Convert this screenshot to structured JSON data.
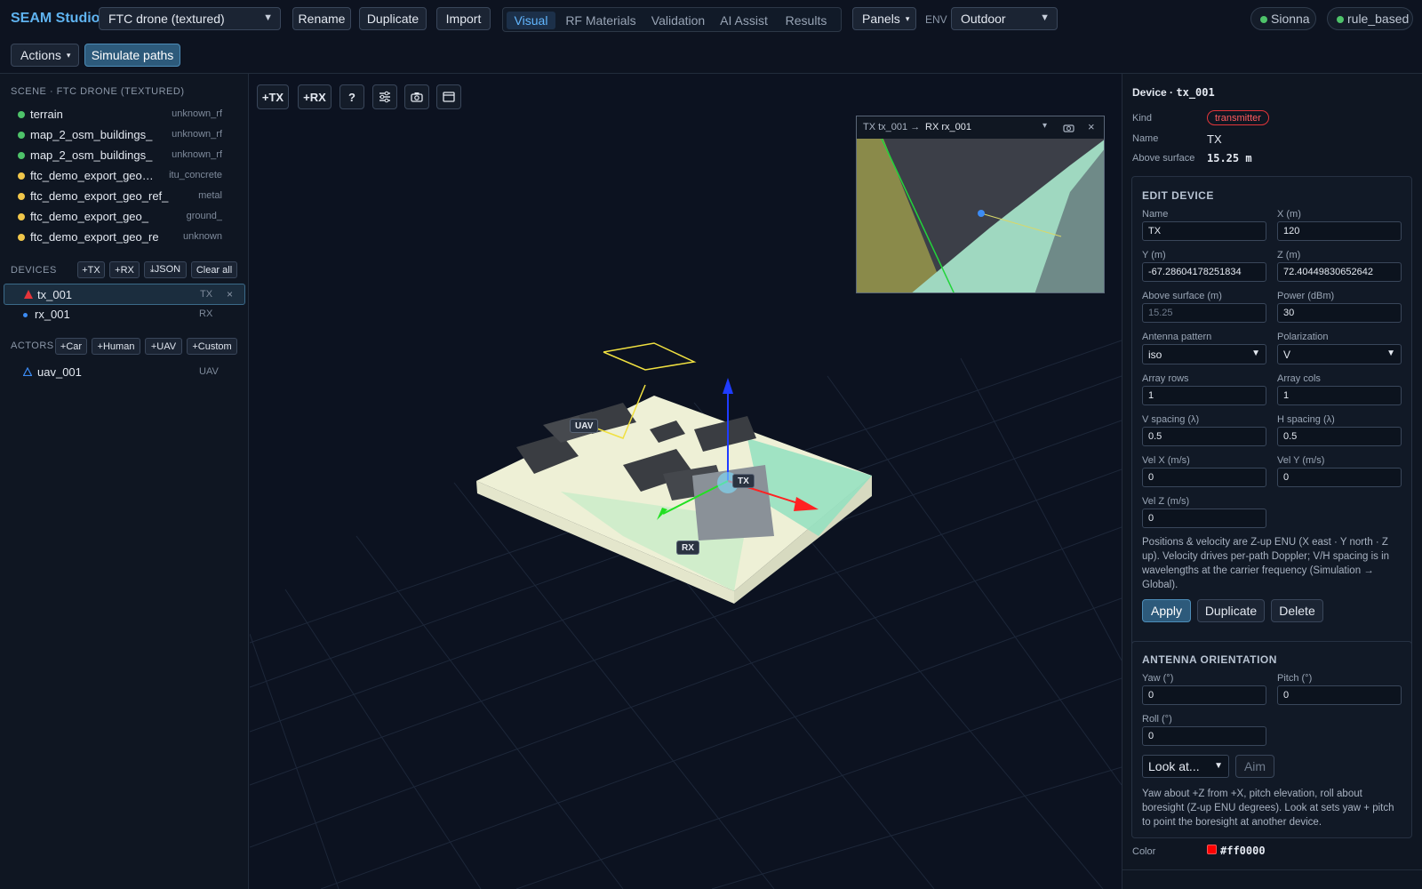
{
  "app": {
    "brand": "SEAM Studio",
    "scene_select": "FTC drone (textured)",
    "rename": "Rename",
    "duplicate": "Duplicate",
    "import": "Import",
    "tabs": [
      "Visual",
      "RF Materials",
      "Validation",
      "AI Assist",
      "Results"
    ],
    "panels": "Panels",
    "env_label": "ENV",
    "env_value": "Outdoor",
    "status_pills": [
      "Sionna",
      "rule_based"
    ],
    "actions": "Actions",
    "simulate": "Simulate paths"
  },
  "scene": {
    "title": "SCENE · FTC DRONE (TEXTURED)",
    "items": [
      {
        "name": "terrain",
        "tag": "unknown_rf",
        "color": "#4ec36a"
      },
      {
        "name": "map_2_osm_buildings_",
        "tag": "unknown_rf",
        "color": "#4ec36a"
      },
      {
        "name": "map_2_osm_buildings_",
        "tag": "unknown_rf",
        "color": "#4ec36a"
      },
      {
        "name": "ftc_demo_export_geo_ref",
        "tag": "itu_concrete",
        "color": "#f0c64a"
      },
      {
        "name": "ftc_demo_export_geo_ref_",
        "tag": "metal",
        "color": "#f0c64a"
      },
      {
        "name": "ftc_demo_export_geo_",
        "tag": "ground_",
        "color": "#f0c64a"
      },
      {
        "name": "ftc_demo_export_geo_re",
        "tag": "unknown",
        "color": "#f0c64a"
      }
    ]
  },
  "devices": {
    "title": "DEVICES",
    "buttons": [
      "+TX",
      "+RX",
      "⤓JSON",
      "Clear all"
    ],
    "items": [
      {
        "name": "tx_001",
        "kind": "TX"
      },
      {
        "name": "rx_001",
        "kind": "RX"
      }
    ],
    "remove": "×"
  },
  "actors": {
    "title": "ACTORS",
    "buttons": [
      "+Car",
      "+Human",
      "+UAV",
      "+Custom"
    ],
    "items": [
      {
        "name": "uav_001",
        "kind": "UAV"
      }
    ]
  },
  "viewport": {
    "toolbar": [
      "+TX",
      "+RX",
      "?"
    ],
    "labels": {
      "uav": "UAV",
      "tx": "TX",
      "rx": "RX"
    },
    "inset": {
      "tx": "TX tx_001 →",
      "rx": "RX rx_001",
      "close": "×"
    }
  },
  "device_panel": {
    "title_prefix": "Device ·",
    "title_id": "tx_001",
    "kind_label": "Kind",
    "kind_value": "transmitter",
    "name_label": "Name",
    "name_value": "TX",
    "above_label": "Above surface",
    "above_value": "15.25 m",
    "edit": {
      "title": "EDIT DEVICE",
      "name_label": "Name",
      "name": "TX",
      "x_label": "X (m)",
      "x": "120",
      "y_label": "Y (m)",
      "y": "-67.28604178251834",
      "z_label": "Z (m)",
      "z": "72.40449830652642",
      "above_label": "Above surface (m)",
      "above": "15.25",
      "power_label": "Power (dBm)",
      "power": "30",
      "pattern_label": "Antenna pattern",
      "pattern": "iso",
      "pol_label": "Polarization",
      "pol": "V",
      "rows_label": "Array rows",
      "rows": "1",
      "cols_label": "Array cols",
      "cols": "1",
      "vsp_label": "V spacing (λ)",
      "vsp": "0.5",
      "hsp_label": "H spacing (λ)",
      "hsp": "0.5",
      "velx_label": "Vel X (m/s)",
      "velx": "0",
      "vely_label": "Vel Y (m/s)",
      "vely": "0",
      "velz_label": "Vel Z (m/s)",
      "velz": "0",
      "note": "Positions & velocity are Z-up ENU (X east · Y north · Z up). Velocity drives per-path Doppler; V/H spacing is in wavelengths at the carrier frequency (Simulation → Global).",
      "apply": "Apply",
      "duplicate": "Duplicate",
      "delete": "Delete"
    },
    "orient": {
      "title": "ANTENNA ORIENTATION",
      "yaw_label": "Yaw (°)",
      "yaw": "0",
      "pitch_label": "Pitch (°)",
      "pitch": "0",
      "roll_label": "Roll (°)",
      "roll": "0",
      "lookat": "Look at...",
      "aim": "Aim",
      "note": "Yaw about +Z from +X, pitch elevation, roll about boresight (Z-up ENU degrees). Look at sets yaw + pitch to point the boresight at another device."
    },
    "color_label": "Color",
    "color_value": "#ff0000"
  }
}
